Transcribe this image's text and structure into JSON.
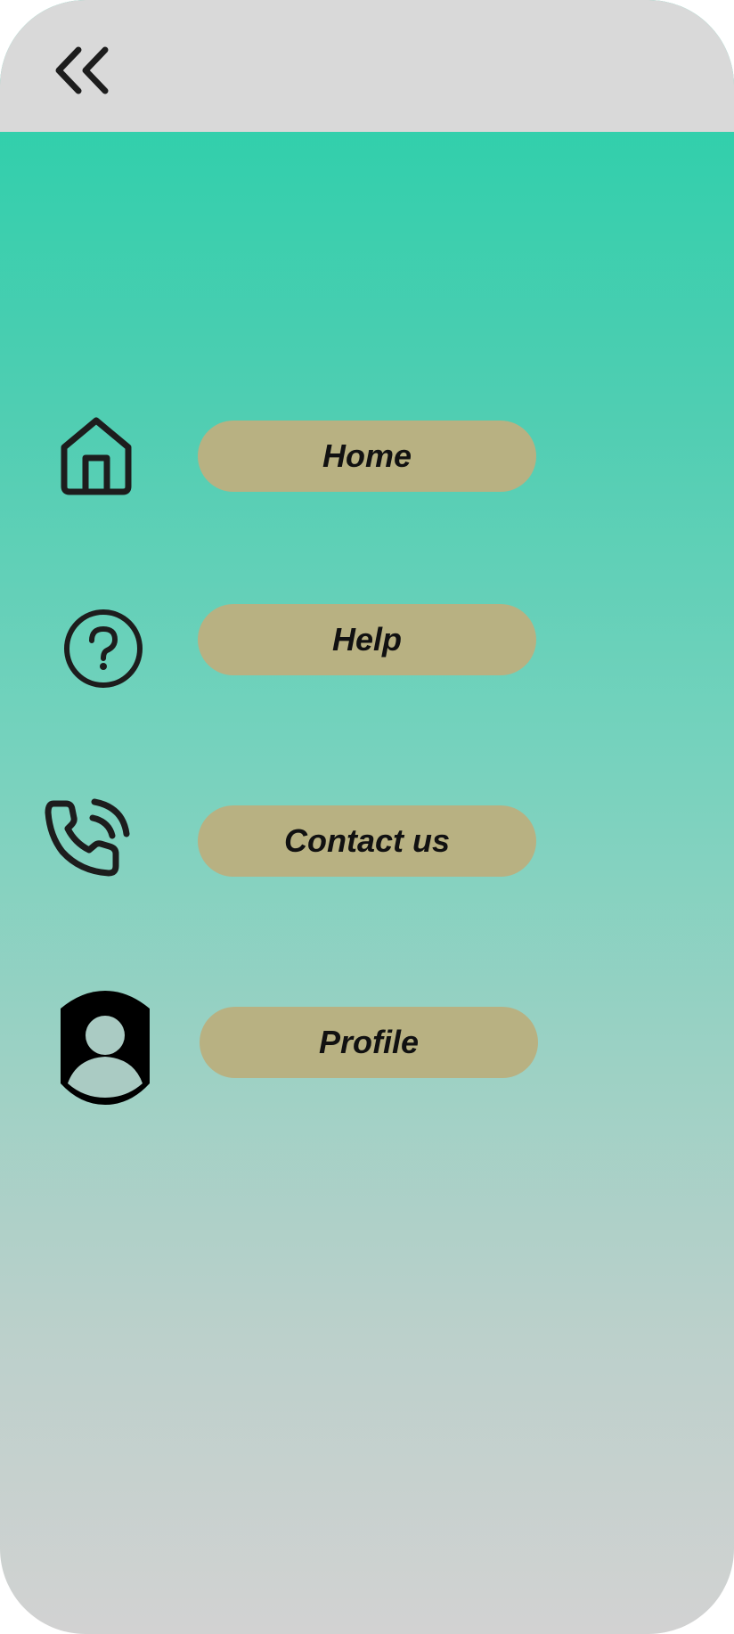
{
  "header": {
    "back_icon": "double-chevron-left-icon"
  },
  "menu": {
    "items": [
      {
        "label": "Home",
        "icon": "home-icon"
      },
      {
        "label": "Help",
        "icon": "help-circle-icon"
      },
      {
        "label": "Contact us",
        "icon": "phone-call-icon"
      },
      {
        "label": "Profile",
        "icon": "user-avatar-icon"
      }
    ]
  },
  "colors": {
    "header_bg": "#d9d9d9",
    "gradient_top": "#24d0a9",
    "gradient_bottom": "#d2d2d2",
    "pill_bg": "#b8b182",
    "icon_stroke": "#1d1d1d"
  }
}
